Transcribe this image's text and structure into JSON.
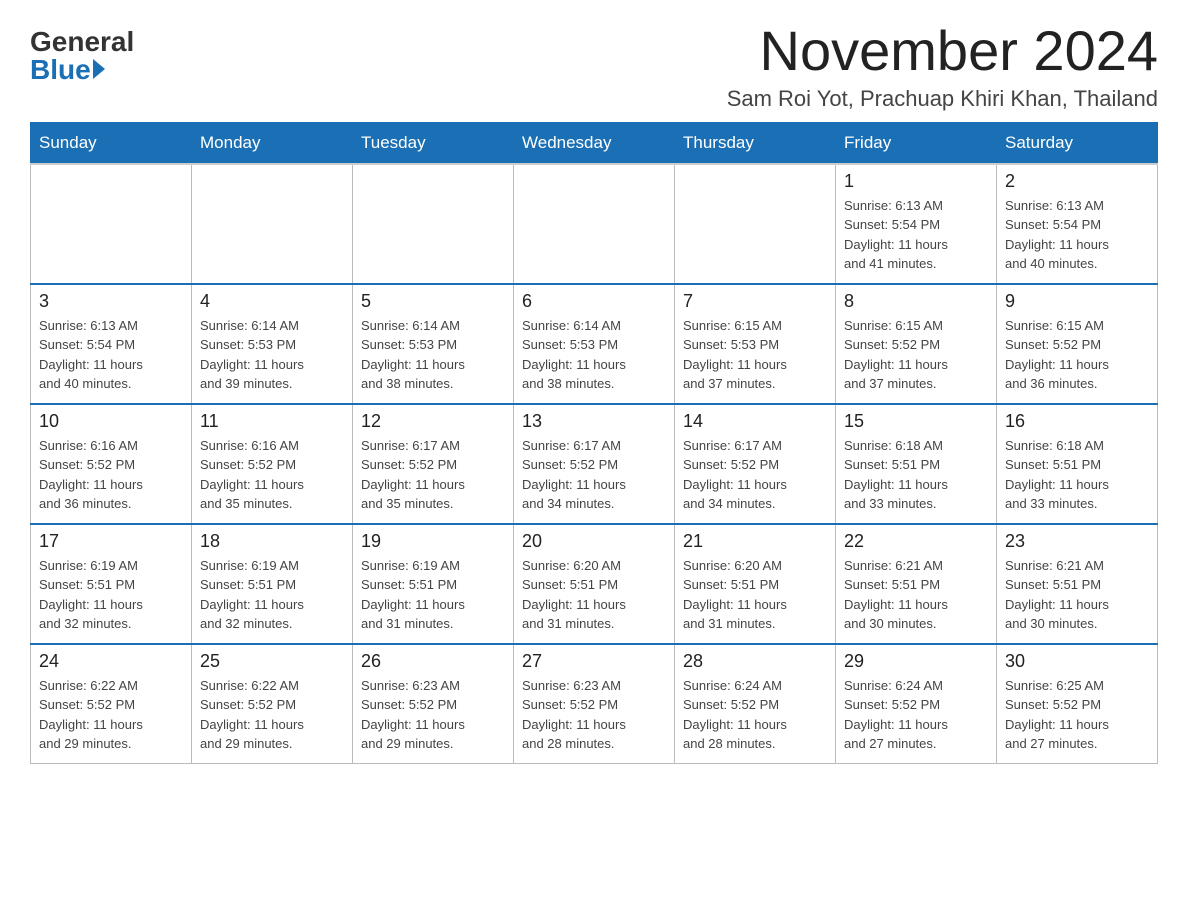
{
  "header": {
    "logo_general": "General",
    "logo_blue": "Blue",
    "month_title": "November 2024",
    "location": "Sam Roi Yot, Prachuap Khiri Khan, Thailand"
  },
  "calendar": {
    "days_of_week": [
      "Sunday",
      "Monday",
      "Tuesday",
      "Wednesday",
      "Thursday",
      "Friday",
      "Saturday"
    ],
    "weeks": [
      [
        {
          "day": "",
          "info": ""
        },
        {
          "day": "",
          "info": ""
        },
        {
          "day": "",
          "info": ""
        },
        {
          "day": "",
          "info": ""
        },
        {
          "day": "",
          "info": ""
        },
        {
          "day": "1",
          "info": "Sunrise: 6:13 AM\nSunset: 5:54 PM\nDaylight: 11 hours\nand 41 minutes."
        },
        {
          "day": "2",
          "info": "Sunrise: 6:13 AM\nSunset: 5:54 PM\nDaylight: 11 hours\nand 40 minutes."
        }
      ],
      [
        {
          "day": "3",
          "info": "Sunrise: 6:13 AM\nSunset: 5:54 PM\nDaylight: 11 hours\nand 40 minutes."
        },
        {
          "day": "4",
          "info": "Sunrise: 6:14 AM\nSunset: 5:53 PM\nDaylight: 11 hours\nand 39 minutes."
        },
        {
          "day": "5",
          "info": "Sunrise: 6:14 AM\nSunset: 5:53 PM\nDaylight: 11 hours\nand 38 minutes."
        },
        {
          "day": "6",
          "info": "Sunrise: 6:14 AM\nSunset: 5:53 PM\nDaylight: 11 hours\nand 38 minutes."
        },
        {
          "day": "7",
          "info": "Sunrise: 6:15 AM\nSunset: 5:53 PM\nDaylight: 11 hours\nand 37 minutes."
        },
        {
          "day": "8",
          "info": "Sunrise: 6:15 AM\nSunset: 5:52 PM\nDaylight: 11 hours\nand 37 minutes."
        },
        {
          "day": "9",
          "info": "Sunrise: 6:15 AM\nSunset: 5:52 PM\nDaylight: 11 hours\nand 36 minutes."
        }
      ],
      [
        {
          "day": "10",
          "info": "Sunrise: 6:16 AM\nSunset: 5:52 PM\nDaylight: 11 hours\nand 36 minutes."
        },
        {
          "day": "11",
          "info": "Sunrise: 6:16 AM\nSunset: 5:52 PM\nDaylight: 11 hours\nand 35 minutes."
        },
        {
          "day": "12",
          "info": "Sunrise: 6:17 AM\nSunset: 5:52 PM\nDaylight: 11 hours\nand 35 minutes."
        },
        {
          "day": "13",
          "info": "Sunrise: 6:17 AM\nSunset: 5:52 PM\nDaylight: 11 hours\nand 34 minutes."
        },
        {
          "day": "14",
          "info": "Sunrise: 6:17 AM\nSunset: 5:52 PM\nDaylight: 11 hours\nand 34 minutes."
        },
        {
          "day": "15",
          "info": "Sunrise: 6:18 AM\nSunset: 5:51 PM\nDaylight: 11 hours\nand 33 minutes."
        },
        {
          "day": "16",
          "info": "Sunrise: 6:18 AM\nSunset: 5:51 PM\nDaylight: 11 hours\nand 33 minutes."
        }
      ],
      [
        {
          "day": "17",
          "info": "Sunrise: 6:19 AM\nSunset: 5:51 PM\nDaylight: 11 hours\nand 32 minutes."
        },
        {
          "day": "18",
          "info": "Sunrise: 6:19 AM\nSunset: 5:51 PM\nDaylight: 11 hours\nand 32 minutes."
        },
        {
          "day": "19",
          "info": "Sunrise: 6:19 AM\nSunset: 5:51 PM\nDaylight: 11 hours\nand 31 minutes."
        },
        {
          "day": "20",
          "info": "Sunrise: 6:20 AM\nSunset: 5:51 PM\nDaylight: 11 hours\nand 31 minutes."
        },
        {
          "day": "21",
          "info": "Sunrise: 6:20 AM\nSunset: 5:51 PM\nDaylight: 11 hours\nand 31 minutes."
        },
        {
          "day": "22",
          "info": "Sunrise: 6:21 AM\nSunset: 5:51 PM\nDaylight: 11 hours\nand 30 minutes."
        },
        {
          "day": "23",
          "info": "Sunrise: 6:21 AM\nSunset: 5:51 PM\nDaylight: 11 hours\nand 30 minutes."
        }
      ],
      [
        {
          "day": "24",
          "info": "Sunrise: 6:22 AM\nSunset: 5:52 PM\nDaylight: 11 hours\nand 29 minutes."
        },
        {
          "day": "25",
          "info": "Sunrise: 6:22 AM\nSunset: 5:52 PM\nDaylight: 11 hours\nand 29 minutes."
        },
        {
          "day": "26",
          "info": "Sunrise: 6:23 AM\nSunset: 5:52 PM\nDaylight: 11 hours\nand 29 minutes."
        },
        {
          "day": "27",
          "info": "Sunrise: 6:23 AM\nSunset: 5:52 PM\nDaylight: 11 hours\nand 28 minutes."
        },
        {
          "day": "28",
          "info": "Sunrise: 6:24 AM\nSunset: 5:52 PM\nDaylight: 11 hours\nand 28 minutes."
        },
        {
          "day": "29",
          "info": "Sunrise: 6:24 AM\nSunset: 5:52 PM\nDaylight: 11 hours\nand 27 minutes."
        },
        {
          "day": "30",
          "info": "Sunrise: 6:25 AM\nSunset: 5:52 PM\nDaylight: 11 hours\nand 27 minutes."
        }
      ]
    ]
  }
}
